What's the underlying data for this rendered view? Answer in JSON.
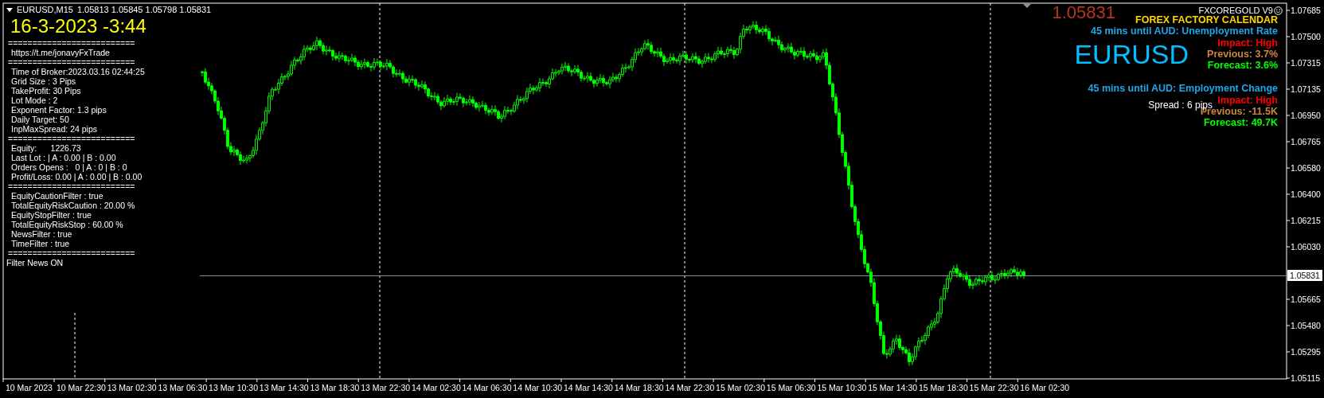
{
  "chart_header": {
    "symbol": "EURUSD,M15",
    "quotes": "1.05813 1.05845 1.05798 1.05831"
  },
  "info_panel": {
    "date_time": "16-3-2023 -3:44",
    "lines": [
      {
        "kind": "separator",
        "text": "=========================="
      },
      {
        "kind": "text",
        "text": "https://t.me/jonavyFxTrade"
      },
      {
        "kind": "separator",
        "text": "=========================="
      },
      {
        "kind": "text",
        "text": "Time of Broker:2023.03.16 02:44:25"
      },
      {
        "kind": "text",
        "text": "Grid Size : 3 Pips"
      },
      {
        "kind": "text",
        "text": "TakeProfit: 30 Pips"
      },
      {
        "kind": "text",
        "text": "Lot Mode : 2"
      },
      {
        "kind": "text",
        "text": "Exponent Factor: 1.3 pips"
      },
      {
        "kind": "text",
        "text": "Daily Target: 50"
      },
      {
        "kind": "text",
        "text": "InpMaxSpread: 24 pips"
      },
      {
        "kind": "separator",
        "text": "=========================="
      },
      {
        "kind": "text",
        "text": "Equity:      1226.73"
      },
      {
        "kind": "text",
        "text": "Last Lot : | A : 0.00 | B : 0.00"
      },
      {
        "kind": "text",
        "text": "Orders Opens :   0 | A : 0 | B : 0"
      },
      {
        "kind": "text",
        "text": "Profit/Loss: 0.00 | A : 0.00 | B : 0.00"
      },
      {
        "kind": "separator",
        "text": "=========================="
      },
      {
        "kind": "text",
        "text": "EquityCautionFilter : true"
      },
      {
        "kind": "text",
        "text": "TotalEquityRiskCaution : 20.00 %"
      },
      {
        "kind": "text",
        "text": "EquityStopFilter : true"
      },
      {
        "kind": "text",
        "text": "TotalEquityRiskStop : 60.00 %"
      },
      {
        "kind": "text",
        "text": "NewsFilter : true"
      },
      {
        "kind": "text",
        "text": "TimeFilter : true"
      },
      {
        "kind": "separator",
        "text": "=========================="
      },
      {
        "kind": "status",
        "text": "Filter News ON"
      }
    ]
  },
  "indicator_label": "FXCOREGOLD V9",
  "calendar": {
    "title": "FOREX FACTORY CALENDAR",
    "events": [
      {
        "countdown": "45 mins until AUD: Unemployment Rate",
        "impact": "Impact: High",
        "previous": "Previous: 3.7%",
        "forecast": "Forecast: 3.6%"
      },
      {
        "countdown": "45 mins until AUD: Employment Change",
        "impact": "Impact: High",
        "previous": "Previous: -11.5K",
        "forecast": "Forecast: 49.7K"
      }
    ]
  },
  "overlays": {
    "price": "1.05831",
    "symbol": "EURUSD",
    "spread": "Spread : 6 pips"
  },
  "price_axis": {
    "labels": [
      "1.07685",
      "1.07500",
      "1.07315",
      "1.07135",
      "1.06950",
      "1.06765",
      "1.06580",
      "1.06400",
      "1.06215",
      "1.06030",
      "1.05665",
      "1.05480",
      "1.05295",
      "1.05115"
    ],
    "current": "1.05831"
  },
  "time_axis": {
    "labels": [
      "10 Mar 2023",
      "10 Mar 22:30",
      "13 Mar 02:30",
      "13 Mar 06:30",
      "13 Mar 10:30",
      "13 Mar 14:30",
      "13 Mar 18:30",
      "13 Mar 22:30",
      "14 Mar 02:30",
      "14 Mar 06:30",
      "14 Mar 10:30",
      "14 Mar 14:30",
      "14 Mar 18:30",
      "14 Mar 22:30",
      "15 Mar 02:30",
      "15 Mar 06:30",
      "15 Mar 10:30",
      "15 Mar 14:30",
      "15 Mar 18:30",
      "15 Mar 22:30",
      "16 Mar 02:30"
    ]
  }
}
